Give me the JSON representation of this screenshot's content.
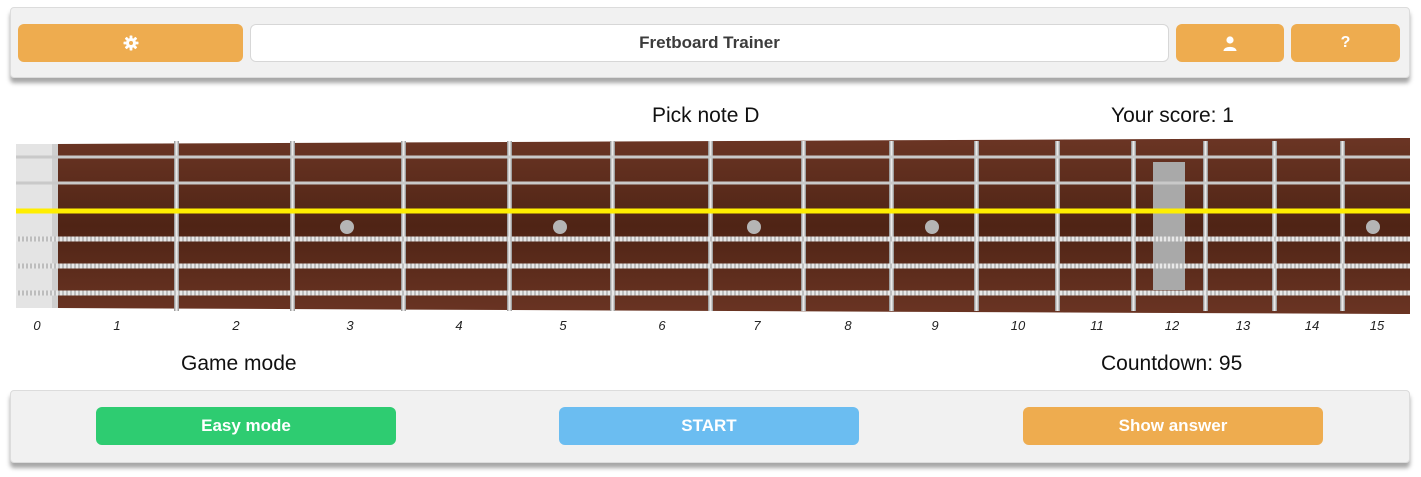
{
  "header": {
    "settings_icon": "gear-icon",
    "title": "Fretboard Trainer",
    "user_icon": "user-icon",
    "help_icon": "?"
  },
  "status": {
    "prompt": "Pick note D",
    "score": "Your score: 1",
    "game_mode": "Game mode",
    "countdown": "Countdown: 95"
  },
  "fretboard": {
    "fret_numbers": [
      "0",
      "1",
      "2",
      "3",
      "4",
      "5",
      "6",
      "7",
      "8",
      "9",
      "10",
      "11",
      "12",
      "13",
      "14",
      "15"
    ],
    "highlighted_string": 3,
    "string_count": 6,
    "marker_frets": [
      3,
      5,
      7,
      9,
      15
    ],
    "double_marker_fret": 12,
    "highlight_color": "#ffee00",
    "wood_color": "#5a2a1a"
  },
  "controls": {
    "easy_mode": "Easy mode",
    "start": "START",
    "show_answer": "Show answer"
  },
  "colors": {
    "orange": "#eeac4f",
    "green": "#2ecc71",
    "blue": "#6bbdf1"
  }
}
